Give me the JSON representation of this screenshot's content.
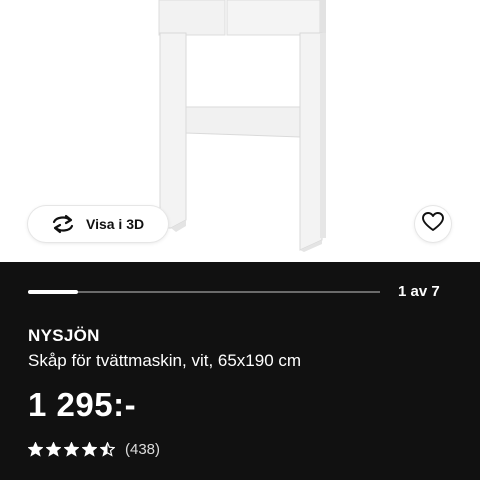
{
  "image": {
    "view_3d_label": "Visa i 3D",
    "view_3d_icon": "rotate-arrows-icon",
    "favorite_icon": "heart-icon"
  },
  "carousel": {
    "counter": "1 av 7",
    "current": 1,
    "total": 7
  },
  "product": {
    "name": "NYSJÖN",
    "description": "Skåp för tvättmaskin, vit, 65x190 cm",
    "price": "1 295:-",
    "rating": 4.5,
    "rating_count": "(438)"
  },
  "colors": {
    "panel_bg": "#111111",
    "text": "#ffffff",
    "star": "#ffffff"
  }
}
